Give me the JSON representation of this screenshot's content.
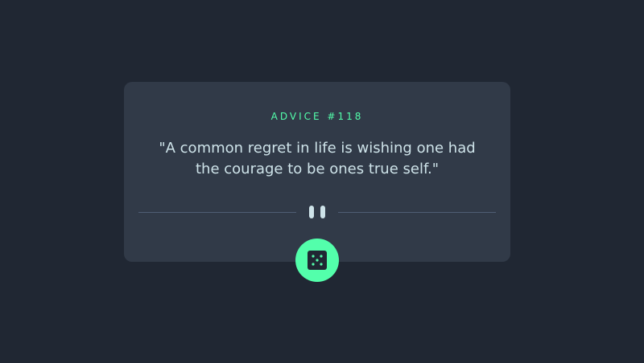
{
  "card": {
    "advice_id": "ADVICE #118",
    "advice_text": "\"A common regret in life is wishing one had the courage to be ones true self.\""
  },
  "divider": {
    "icon": "pause-icon"
  },
  "button": {
    "icon": "dice-icon"
  },
  "colors": {
    "background": "#202733",
    "card": "#313a48",
    "accent": "#53ffab",
    "text": "#cee3e9",
    "divider_line": "#4f5d74"
  }
}
